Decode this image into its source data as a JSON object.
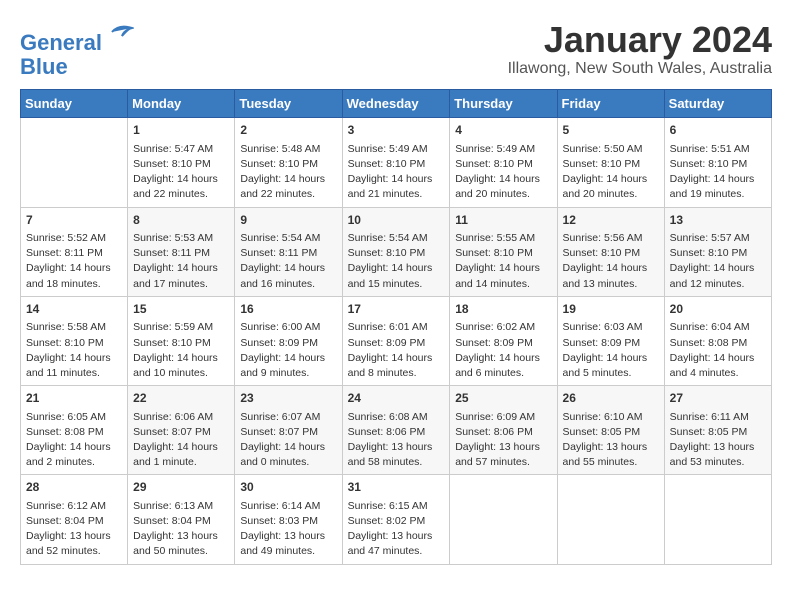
{
  "logo": {
    "line1": "General",
    "line2": "Blue"
  },
  "title": "January 2024",
  "subtitle": "Illawong, New South Wales, Australia",
  "days_of_week": [
    "Sunday",
    "Monday",
    "Tuesday",
    "Wednesday",
    "Thursday",
    "Friday",
    "Saturday"
  ],
  "weeks": [
    [
      {
        "day": "",
        "info": ""
      },
      {
        "day": "1",
        "info": "Sunrise: 5:47 AM\nSunset: 8:10 PM\nDaylight: 14 hours\nand 22 minutes."
      },
      {
        "day": "2",
        "info": "Sunrise: 5:48 AM\nSunset: 8:10 PM\nDaylight: 14 hours\nand 22 minutes."
      },
      {
        "day": "3",
        "info": "Sunrise: 5:49 AM\nSunset: 8:10 PM\nDaylight: 14 hours\nand 21 minutes."
      },
      {
        "day": "4",
        "info": "Sunrise: 5:49 AM\nSunset: 8:10 PM\nDaylight: 14 hours\nand 20 minutes."
      },
      {
        "day": "5",
        "info": "Sunrise: 5:50 AM\nSunset: 8:10 PM\nDaylight: 14 hours\nand 20 minutes."
      },
      {
        "day": "6",
        "info": "Sunrise: 5:51 AM\nSunset: 8:10 PM\nDaylight: 14 hours\nand 19 minutes."
      }
    ],
    [
      {
        "day": "7",
        "info": "Sunrise: 5:52 AM\nSunset: 8:11 PM\nDaylight: 14 hours\nand 18 minutes."
      },
      {
        "day": "8",
        "info": "Sunrise: 5:53 AM\nSunset: 8:11 PM\nDaylight: 14 hours\nand 17 minutes."
      },
      {
        "day": "9",
        "info": "Sunrise: 5:54 AM\nSunset: 8:11 PM\nDaylight: 14 hours\nand 16 minutes."
      },
      {
        "day": "10",
        "info": "Sunrise: 5:54 AM\nSunset: 8:10 PM\nDaylight: 14 hours\nand 15 minutes."
      },
      {
        "day": "11",
        "info": "Sunrise: 5:55 AM\nSunset: 8:10 PM\nDaylight: 14 hours\nand 14 minutes."
      },
      {
        "day": "12",
        "info": "Sunrise: 5:56 AM\nSunset: 8:10 PM\nDaylight: 14 hours\nand 13 minutes."
      },
      {
        "day": "13",
        "info": "Sunrise: 5:57 AM\nSunset: 8:10 PM\nDaylight: 14 hours\nand 12 minutes."
      }
    ],
    [
      {
        "day": "14",
        "info": "Sunrise: 5:58 AM\nSunset: 8:10 PM\nDaylight: 14 hours\nand 11 minutes."
      },
      {
        "day": "15",
        "info": "Sunrise: 5:59 AM\nSunset: 8:10 PM\nDaylight: 14 hours\nand 10 minutes."
      },
      {
        "day": "16",
        "info": "Sunrise: 6:00 AM\nSunset: 8:09 PM\nDaylight: 14 hours\nand 9 minutes."
      },
      {
        "day": "17",
        "info": "Sunrise: 6:01 AM\nSunset: 8:09 PM\nDaylight: 14 hours\nand 8 minutes."
      },
      {
        "day": "18",
        "info": "Sunrise: 6:02 AM\nSunset: 8:09 PM\nDaylight: 14 hours\nand 6 minutes."
      },
      {
        "day": "19",
        "info": "Sunrise: 6:03 AM\nSunset: 8:09 PM\nDaylight: 14 hours\nand 5 minutes."
      },
      {
        "day": "20",
        "info": "Sunrise: 6:04 AM\nSunset: 8:08 PM\nDaylight: 14 hours\nand 4 minutes."
      }
    ],
    [
      {
        "day": "21",
        "info": "Sunrise: 6:05 AM\nSunset: 8:08 PM\nDaylight: 14 hours\nand 2 minutes."
      },
      {
        "day": "22",
        "info": "Sunrise: 6:06 AM\nSunset: 8:07 PM\nDaylight: 14 hours\nand 1 minute."
      },
      {
        "day": "23",
        "info": "Sunrise: 6:07 AM\nSunset: 8:07 PM\nDaylight: 14 hours\nand 0 minutes."
      },
      {
        "day": "24",
        "info": "Sunrise: 6:08 AM\nSunset: 8:06 PM\nDaylight: 13 hours\nand 58 minutes."
      },
      {
        "day": "25",
        "info": "Sunrise: 6:09 AM\nSunset: 8:06 PM\nDaylight: 13 hours\nand 57 minutes."
      },
      {
        "day": "26",
        "info": "Sunrise: 6:10 AM\nSunset: 8:05 PM\nDaylight: 13 hours\nand 55 minutes."
      },
      {
        "day": "27",
        "info": "Sunrise: 6:11 AM\nSunset: 8:05 PM\nDaylight: 13 hours\nand 53 minutes."
      }
    ],
    [
      {
        "day": "28",
        "info": "Sunrise: 6:12 AM\nSunset: 8:04 PM\nDaylight: 13 hours\nand 52 minutes."
      },
      {
        "day": "29",
        "info": "Sunrise: 6:13 AM\nSunset: 8:04 PM\nDaylight: 13 hours\nand 50 minutes."
      },
      {
        "day": "30",
        "info": "Sunrise: 6:14 AM\nSunset: 8:03 PM\nDaylight: 13 hours\nand 49 minutes."
      },
      {
        "day": "31",
        "info": "Sunrise: 6:15 AM\nSunset: 8:02 PM\nDaylight: 13 hours\nand 47 minutes."
      },
      {
        "day": "",
        "info": ""
      },
      {
        "day": "",
        "info": ""
      },
      {
        "day": "",
        "info": ""
      }
    ]
  ]
}
